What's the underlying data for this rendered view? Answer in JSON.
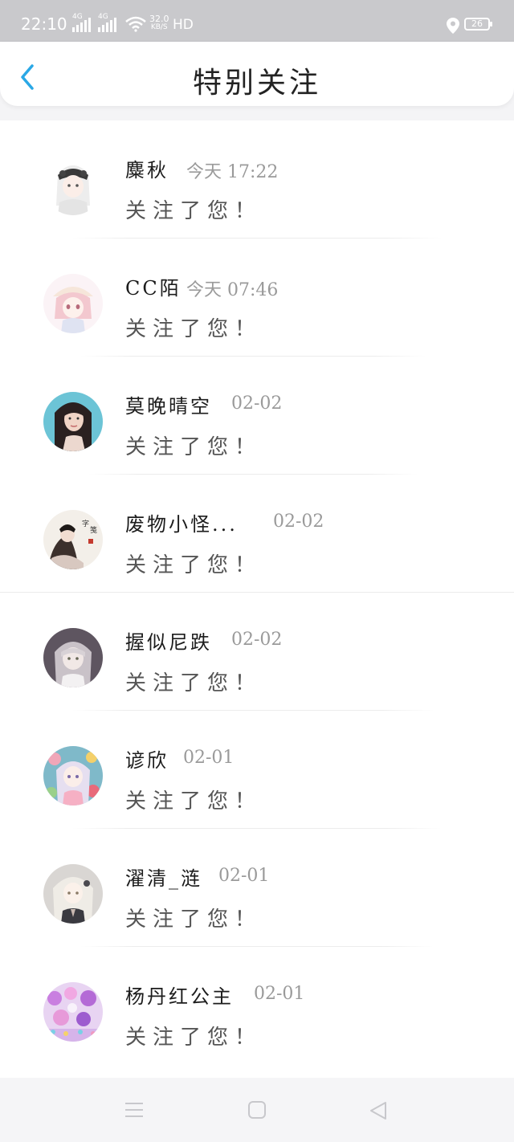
{
  "status_bar": {
    "time": "22:10",
    "signal_1": "4G",
    "signal_2": "4G",
    "net_speed_value": "32.0",
    "net_speed_unit": "KB/S",
    "hd": "HD",
    "battery": "26"
  },
  "header": {
    "title": "特别关注",
    "back_icon": "chevron-left-icon",
    "accent_color": "#2aa8e6"
  },
  "notifications": [
    {
      "name": "麋秋",
      "time": "今天 17:22",
      "message": "关注了您！",
      "avatar": "avatar-anime-white-hair"
    },
    {
      "name": "CC陌",
      "time": "今天 07:46",
      "message": "关注了您！",
      "avatar": "avatar-anime-pink-hat"
    },
    {
      "name": "莫晚晴空",
      "time": "02-02",
      "message": "关注了您！",
      "avatar": "avatar-photo-woman"
    },
    {
      "name": "废物小怪...",
      "time": "02-02",
      "message": "关注了您！",
      "avatar": "avatar-ink-painting"
    },
    {
      "name": "握似尼跌",
      "time": "02-02",
      "message": "关注了您！",
      "avatar": "avatar-anime-grey"
    },
    {
      "name": "谚欣",
      "time": "02-01",
      "message": "关注了您！",
      "avatar": "avatar-anime-colorful"
    },
    {
      "name": "濯清_涟",
      "time": "02-01",
      "message": "关注了您！",
      "avatar": "avatar-anime-silver-hair"
    },
    {
      "name": "杨丹红公主",
      "time": "02-01",
      "message": "关注了您！",
      "avatar": "avatar-purple-flowers"
    }
  ],
  "nav_bar": {
    "menu_icon": "menu-icon",
    "home_icon": "home-square-icon",
    "back_icon": "back-triangle-icon"
  }
}
